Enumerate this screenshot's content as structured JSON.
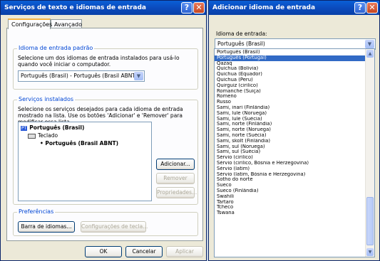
{
  "left_dialog": {
    "title": "Serviços de texto e idiomas de entrada",
    "help_btn": "?",
    "close_btn": "✕",
    "tabs": [
      "Configurações",
      "Avançado"
    ],
    "default_group": {
      "legend": "Idioma de entrada padrão",
      "description": "Selecione um dos idiomas de entrada instalados para usá-lo quando você iniciar o computador.",
      "combo_value": "Português (Brasil) - Português (Brasil ABNT)"
    },
    "installed_group": {
      "legend": "Serviços instalados",
      "description": "Selecione os serviços desejados para cada idioma de entrada mostrado na lista. Use os botões 'Adicionar' e 'Remover' para modificar essa lista.",
      "tree": {
        "lang_badge": "PT",
        "language": "Português (Brasil)",
        "category": "Teclado",
        "layout": "Português (Brasil ABNT)"
      },
      "buttons": {
        "add": "Adicionar...",
        "remove": "Remover",
        "properties": "Propriedades..."
      }
    },
    "prefs_group": {
      "legend": "Preferências",
      "lang_bar_btn": "Barra de idiomas...",
      "key_settings_btn": "Configurações de tecla..."
    },
    "footer": {
      "ok": "OK",
      "cancel": "Cancelar",
      "apply": "Aplicar"
    }
  },
  "right_dialog": {
    "title": "Adicionar idioma de entrada",
    "help_btn": "?",
    "close_btn": "✕",
    "label": "Idioma de entrada:",
    "combo_value": "Português (Brasil)",
    "selected_index": 1,
    "list": [
      "Português (Brasil)",
      "Português (Portugal)",
      "Qazaq",
      "Quíchua (Bolívia)",
      "Quíchua (Equador)",
      "Quíchua (Peru)",
      "Quirguiz (cirílico)",
      "Romanche (Suíça)",
      "Romeno",
      "Russo",
      "Sami, inari (Finlândia)",
      "Sami, lule (Noruega)",
      "Sami, lule (Suécia)",
      "Sami, norte (Finlândia)",
      "Sami, norte (Noruega)",
      "Sami, norte (Suécia)",
      "Sami, skolt (Finlândia)",
      "Sami, sul (Noruega)",
      "Sami, sul (Suécia)",
      "Sérvio (cirílico)",
      "Sérvio (cirílico, Bósnia e Herzegovina)",
      "Sérvio (latim)",
      "Sérvio (latim, Bósnia e Herzegovina)",
      "Sotho do norte",
      "Sueco",
      "Sueco (Finlândia)",
      "Swahili",
      "Tártaro",
      "Tcheco",
      "Tswana"
    ]
  },
  "colors": {
    "title_bar": "#0b4bbd",
    "selection": "#316ac5",
    "group_legend": "#0046d5",
    "dialog_bg": "#ece9d8"
  }
}
